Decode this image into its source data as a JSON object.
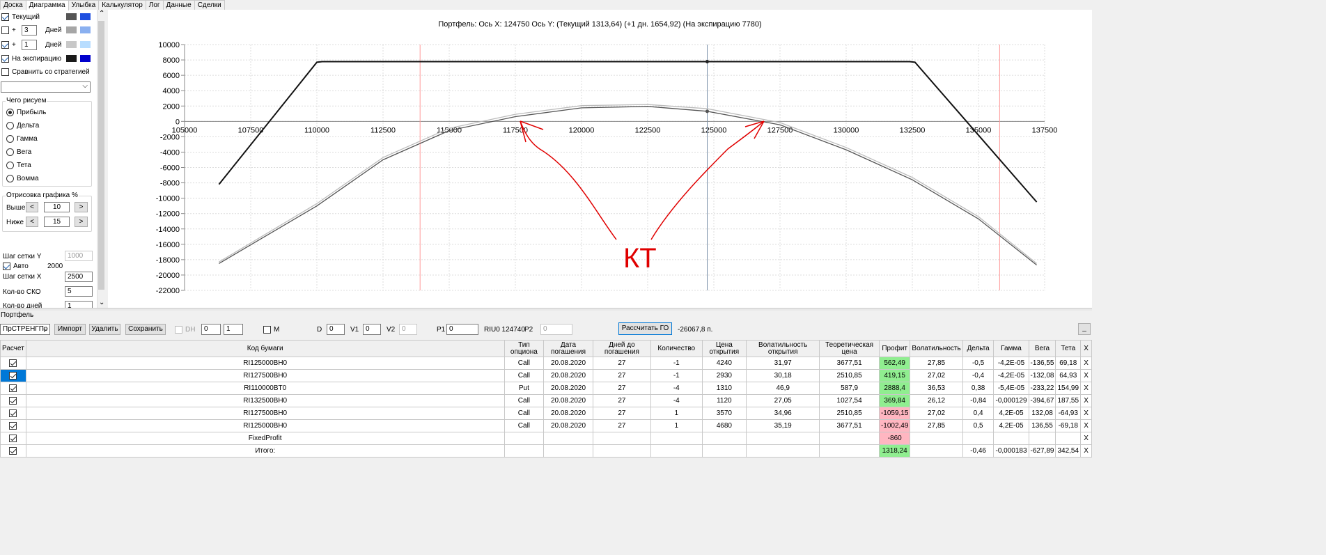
{
  "tabs": [
    "Доска",
    "Диаграмма",
    "Улыбка",
    "Калькулятор",
    "Лог",
    "Данные",
    "Сделки"
  ],
  "active_tab": "Диаграмма",
  "left_panel": {
    "row1": {
      "label": "Текущий",
      "checked": true,
      "swatch1": "#555555",
      "swatch2": "#1f4fe0"
    },
    "row2": {
      "plus": "+",
      "days_value": "3",
      "days_label": "Дней",
      "swatch1": "#a6a6a6",
      "swatch2": "#8ab0f0"
    },
    "row3": {
      "plus": "+",
      "days_value": "1",
      "days_label": "Дней",
      "swatch1": "#c8c8c8",
      "swatch2": "#b8ddff"
    },
    "row4": {
      "label": "На экспирацию",
      "checked": true,
      "swatch1": "#1a1a1a",
      "swatch2": "#0000cc"
    },
    "compare_label": "Сравнить со стратегией",
    "what_group": "Чего рисуем",
    "radios": [
      "Прибыль",
      "Дельта",
      "Гамма",
      "Вега",
      "Тета",
      "Вомма"
    ],
    "draw_group": "Отрисовка графика %",
    "above_label": "Выше",
    "above_value": "10",
    "below_label": "Ниже",
    "below_value": "15",
    "btn_left": "<",
    "btn_right": ">",
    "grid_y_label": "Шаг сетки Y",
    "grid_y_value": "1000",
    "auto_label": "Авто",
    "auto_value": "2000",
    "grid_x_label": "Шаг сетки X",
    "grid_x_value": "2500",
    "sko_label": "Кол-во СКО",
    "sko_value": "5",
    "days_count_label": "Кол-во дней",
    "days_count_value": "1"
  },
  "chart_data": {
    "type": "line",
    "title": "Портфель: Ось X: 124750 Ось Y:  (Текущий 1313,64)  (+1 дн. 1654,92)  (На экспирацию 7780)",
    "xlim": [
      105000,
      137500
    ],
    "ylim": [
      -22000,
      10000
    ],
    "x_ticks": [
      "105000",
      "107500",
      "110000",
      "112500",
      "115000",
      "117500",
      "120000",
      "122500",
      "125000",
      "127500",
      "130000",
      "132500",
      "135000",
      "137500"
    ],
    "y_ticks": [
      "10000",
      "8000",
      "6000",
      "4000",
      "2000",
      "0",
      "-2000",
      "-4000",
      "-6000",
      "-8000",
      "-10000",
      "-12000",
      "-14000",
      "-16000",
      "-18000",
      "-20000",
      "-22000"
    ],
    "cursor_x": 124750,
    "red_lines_x": [
      113900,
      135800
    ],
    "series": [
      {
        "color": "#111111",
        "x": [
          106300,
          110000,
          110200,
          132400,
          132600,
          137200
        ],
        "y": [
          -8200,
          7700,
          7780,
          7780,
          7700,
          -10500
        ]
      },
      {
        "color": "#555555",
        "x": [
          106300,
          110000,
          112500,
          115000,
          117500,
          120000,
          122500,
          124750,
          127500,
          130000,
          132500,
          135000,
          137200
        ],
        "y": [
          -18500,
          -11000,
          -5000,
          -1200,
          620,
          1760,
          1950,
          1313,
          -450,
          -3700,
          -7600,
          -12700,
          -18700
        ]
      },
      {
        "color": "#bbbbbb",
        "x": [
          106300,
          110000,
          112500,
          115000,
          117500,
          120000,
          122500,
          124750,
          127500,
          130000,
          132500,
          135000,
          137200
        ],
        "y": [
          -18300,
          -10700,
          -4700,
          -900,
          920,
          2050,
          2200,
          1655,
          -150,
          -3400,
          -7300,
          -12400,
          -18500
        ]
      }
    ],
    "annotation": "КТ"
  },
  "portfolio_label": "Портфель",
  "toolbar": {
    "combo": "ПрСТРЕНГПр",
    "import": "Импорт",
    "delete": "Удалить",
    "save": "Сохранить",
    "dh": "DH",
    "dh_val1": "0",
    "dh_val2": "1",
    "m": "M",
    "d_label": "D",
    "d_val": "0",
    "v1_label": "V1",
    "v1_val": "0",
    "v2_label": "V2",
    "v2_val": "0",
    "p1_label": "P1",
    "p1_val": "0",
    "riu": "RIU0 124740",
    "p2_label": "P2",
    "p2_val": "0",
    "calc_go": "Рассчитать ГО",
    "go_value": "-26067,8 п.",
    "min_btn": "_"
  },
  "table": {
    "headers": [
      "Расчет",
      "Код бумаги",
      "Тип\nопциона",
      "Дата\nпогашения",
      "Дней до\nпогашения",
      "Количество",
      "Цена\nоткрытия",
      "Волатильность\nоткрытия",
      "Теоретическая\nцена",
      "Профит",
      "Волатильность",
      "Дельта",
      "Гамма",
      "Вега",
      "Тета",
      "X"
    ],
    "rows": [
      [
        "RI125000BH0",
        "Call",
        "20.08.2020",
        "27",
        "-1",
        "4240",
        "31,97",
        "3677,51",
        "562,49",
        "27,85",
        "-0,5",
        "-4,2E-05",
        "-136,55",
        "69,18",
        "X"
      ],
      [
        "RI127500BH0",
        "Call",
        "20.08.2020",
        "27",
        "-1",
        "2930",
        "30,18",
        "2510,85",
        "419,15",
        "27,02",
        "-0,4",
        "-4,2E-05",
        "-132,08",
        "64,93",
        "X"
      ],
      [
        "RI110000BT0",
        "Put",
        "20.08.2020",
        "27",
        "-4",
        "1310",
        "46,9",
        "587,9",
        "2888,4",
        "36,53",
        "0,38",
        "-5,4E-05",
        "-233,22",
        "154,99",
        "X"
      ],
      [
        "RI132500BH0",
        "Call",
        "20.08.2020",
        "27",
        "-4",
        "1120",
        "27,05",
        "1027,54",
        "369,84",
        "26,12",
        "-0,84",
        "-0,000129",
        "-394,67",
        "187,55",
        "X"
      ],
      [
        "RI127500BH0",
        "Call",
        "20.08.2020",
        "27",
        "1",
        "3570",
        "34,96",
        "2510,85",
        "-1059,15",
        "27,02",
        "0,4",
        "4,2E-05",
        "132,08",
        "-64,93",
        "X"
      ],
      [
        "RI125000BH0",
        "Call",
        "20.08.2020",
        "27",
        "1",
        "4680",
        "35,19",
        "3677,51",
        "-1002,49",
        "27,85",
        "0,5",
        "4,2E-05",
        "136,55",
        "-69,18",
        "X"
      ],
      [
        "FixedProfit",
        "",
        "",
        "",
        "",
        "",
        "",
        "",
        "-860",
        "",
        "",
        "",
        "",
        "",
        "X"
      ],
      [
        "Итого:",
        "",
        "",
        "",
        "",
        "",
        "",
        "",
        "1318,24",
        "",
        "-0,46",
        "-0,000183",
        "-627,89",
        "342,54",
        "X"
      ]
    ],
    "profit_colors": [
      "#90ee90",
      "#90ee90",
      "#90ee90",
      "#90ee90",
      "#ffb6c1",
      "#ffb6c1",
      "#ffb6c1",
      "#90ee90"
    ]
  }
}
